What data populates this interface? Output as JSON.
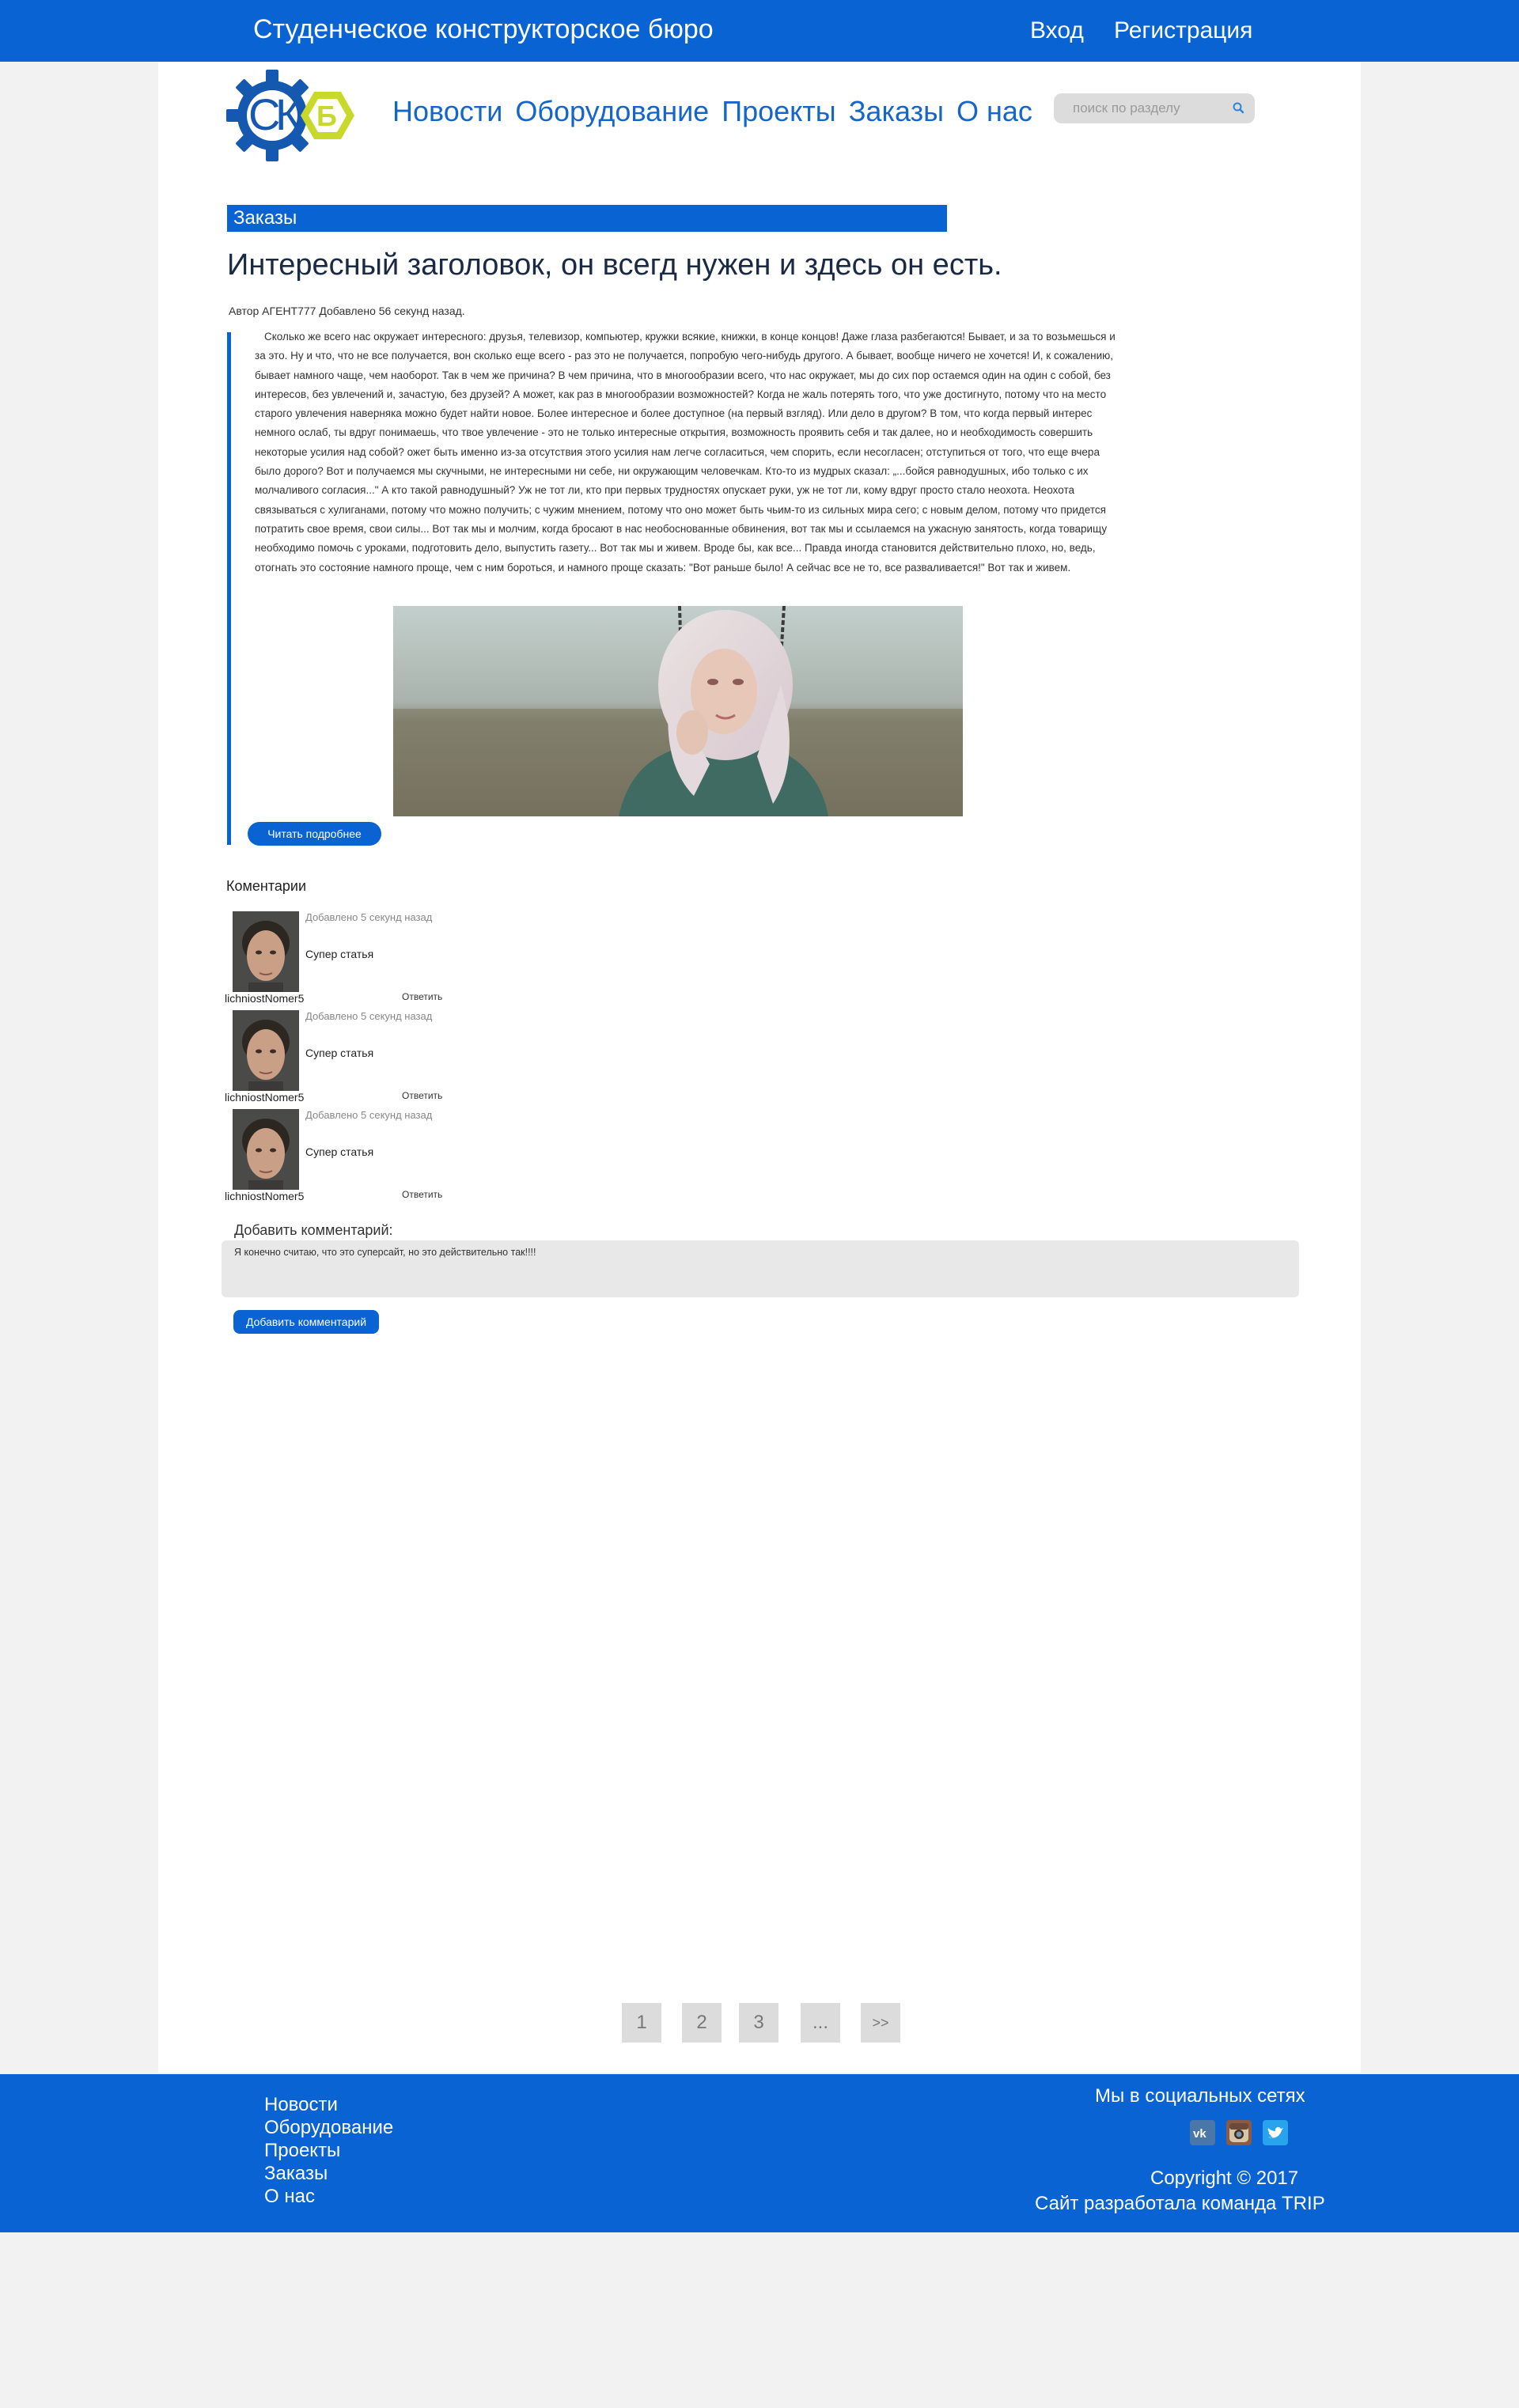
{
  "header": {
    "site_title": "Студенческое конструкторское бюро",
    "login": "Вход",
    "register": "Регистрация"
  },
  "nav": {
    "items": [
      "Новости",
      "Оборудование",
      "Проекты",
      "Заказы",
      "О нас"
    ]
  },
  "search": {
    "placeholder": "поиск по разделу"
  },
  "section": {
    "label": "Заказы"
  },
  "post": {
    "title": "Интересный заголовок, он всегд нужен и здесь он есть.",
    "meta": "Автор АГЕНТ777 Добавлено 56 секунд назад.",
    "body": "Сколько же всего нас окружает интересного: друзья, телевизор, компьютер, кружки всякие, книжки, в конце концов! Даже глаза разбегаются! Бывает, и за то возьмешься и за это. Ну и что, что не все получается, вон сколько еще всего - раз это не получается, попробую чего-нибудь другого. А бывает, вообще ничего не хочется! И, к сожалению, бывает намного чаще, чем наоборот. Так в чем же причина? В чем причина, что в многообразии всего, что нас окружает, мы до сих пор остаемся один на один с собой, без интересов, без увлечений и, зачастую, без друзей?   А может, как раз в многообразии возможностей? Когда не жаль потерять того, что уже достигнуто, потому что на место старого увлечения наверняка можно будет найти новое. Более интересное и более доступное (на первый взгляд).  Или дело в другом? В том, что когда первый интерес немного ослаб, ты вдруг понимаешь, что твое увлечение - это не только интересные открытия, возможность проявить себя и так далее, но и необходимость совершить некоторые усилия над собой? ожет быть именно из-за отсутствия этого усилия нам легче согласиться, чем спорить, если несогласен; отступиться от того, что еще вчера было дорого? Вот и получаемся мы скучными, не интересными ни себе, ни окружающим человечкам. Кто-то из мудрых сказал: „...бойся равнодушных, ибо только с их молчаливого согласия...\" А кто такой равнодушный? Уж не тот ли, кто при первых трудностях опускает руки, уж не тот ли, кому вдруг просто стало неохота. Неохота связываться с хулиганами, потому что можно получить; с чужим мнением, потому что оно может быть чьим-то из сильных мира сего; с новым делом, потому что придется потратить свое время, свои силы...   Вот так мы и молчим, когда бросают в нас необоснованные обвинения, вот так мы и ссылаемся на ужасную занятость, когда товарищу необходимо помочь с уроками, подготовить дело, выпустить газету... Вот так мы и живем. Вроде бы, как все... Правда иногда становится действительно плохо, но, ведь, отогнать это состояние намного проще, чем с ним бороться, и намного проще сказать: \"Вот раньше было! А сейчас все не то, все разваливается!\" Вот так и живем.",
    "read_more": "Читать подробнее"
  },
  "comments": {
    "title": "Коментарии",
    "items": [
      {
        "username": "lichniostNomer5",
        "date": "Добавлено 5 секунд назад",
        "text": "Супер статья",
        "reply": "Ответить"
      },
      {
        "username": "lichniostNomer5",
        "date": "Добавлено 5 секунд назад",
        "text": "Супер статья",
        "reply": "Ответить"
      },
      {
        "username": "lichniostNomer5",
        "date": "Добавлено 5 секунд назад",
        "text": "Супер статья",
        "reply": "Ответить"
      }
    ]
  },
  "add_comment": {
    "label": "Добавить комментарий:",
    "value": "Я конечно считаю, что это суперсайт, но это действительно так!!!!",
    "button": "Добавить комментарий"
  },
  "pagination": [
    "1",
    "2",
    "3",
    "...",
    ">>"
  ],
  "footer": {
    "nav": [
      "Новости",
      "Оборудование",
      "Проекты",
      "Заказы",
      "О нас"
    ],
    "social_title": "Мы в социальных сетях",
    "copyright": "Copyright © 2017",
    "made_by": "Сайт разработала команда TRIP"
  },
  "colors": {
    "brand_blue": "#0a63d3",
    "logo_yellow": "#c9d92c",
    "page_bg": "#f2f2f2"
  },
  "icons": [
    "logo-gear-icon",
    "search-icon",
    "vk-icon",
    "instagram-icon",
    "twitter-icon"
  ]
}
